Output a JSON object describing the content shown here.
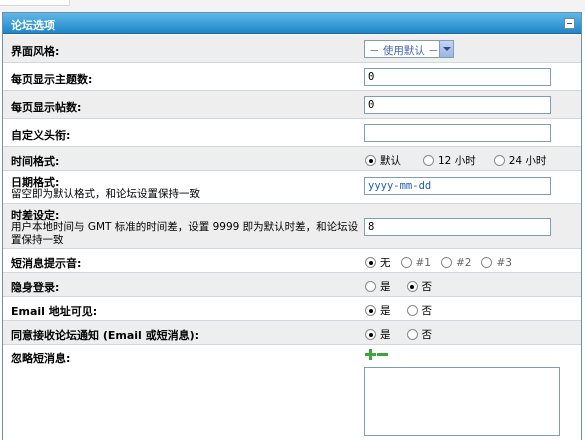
{
  "panel": {
    "title": "论坛选项"
  },
  "rows": {
    "style": {
      "label": "界面风格:",
      "value": "－ 使用默认 －"
    },
    "topics_per_page": {
      "label": "每页显示主题数:",
      "value": "0"
    },
    "posts_per_page": {
      "label": "每页显示帖数:",
      "value": "0"
    },
    "custom_title": {
      "label": "自定义头衔:",
      "value": ""
    },
    "time_format": {
      "label": "时间格式:",
      "options": [
        "默认",
        "12 小时",
        "24 小时"
      ],
      "selected": 0
    },
    "date_format": {
      "label": "日期格式:",
      "desc": "留空即为默认格式，和论坛设置保持一致",
      "value": "yyyy-mm-dd"
    },
    "timezone": {
      "label": "时差设定:",
      "desc_line1": "用户本地时间与 GMT 标准的时间差，设置 9999 即为默认时差，和论坛设",
      "desc_line2": "置保持一致",
      "value": "8"
    },
    "pm_sound": {
      "label": "短消息提示音:",
      "options": [
        "无",
        "#1",
        "#2",
        "#3"
      ],
      "selected": 0
    },
    "invisible": {
      "label": "隐身登录:",
      "options": [
        "是",
        "否"
      ],
      "selected": 1
    },
    "email_visible": {
      "label": "Email 地址可见:",
      "options": [
        "是",
        "否"
      ],
      "selected": 0
    },
    "notify": {
      "label": "同意接收论坛通知 (Email 或短消息):",
      "options": [
        "是",
        "否"
      ],
      "selected": 0
    },
    "ignore_pm": {
      "label": "忽略短消息:",
      "value": ""
    }
  },
  "colors": {
    "header_top": "#5fb8e8",
    "header_bottom": "#1f86c9",
    "alt_row": "#eeeeee",
    "add_icon": "#3aa53a"
  },
  "icons": {
    "collapse": "collapse-minus-icon",
    "add": "plus-icon",
    "remove": "minus-icon"
  }
}
